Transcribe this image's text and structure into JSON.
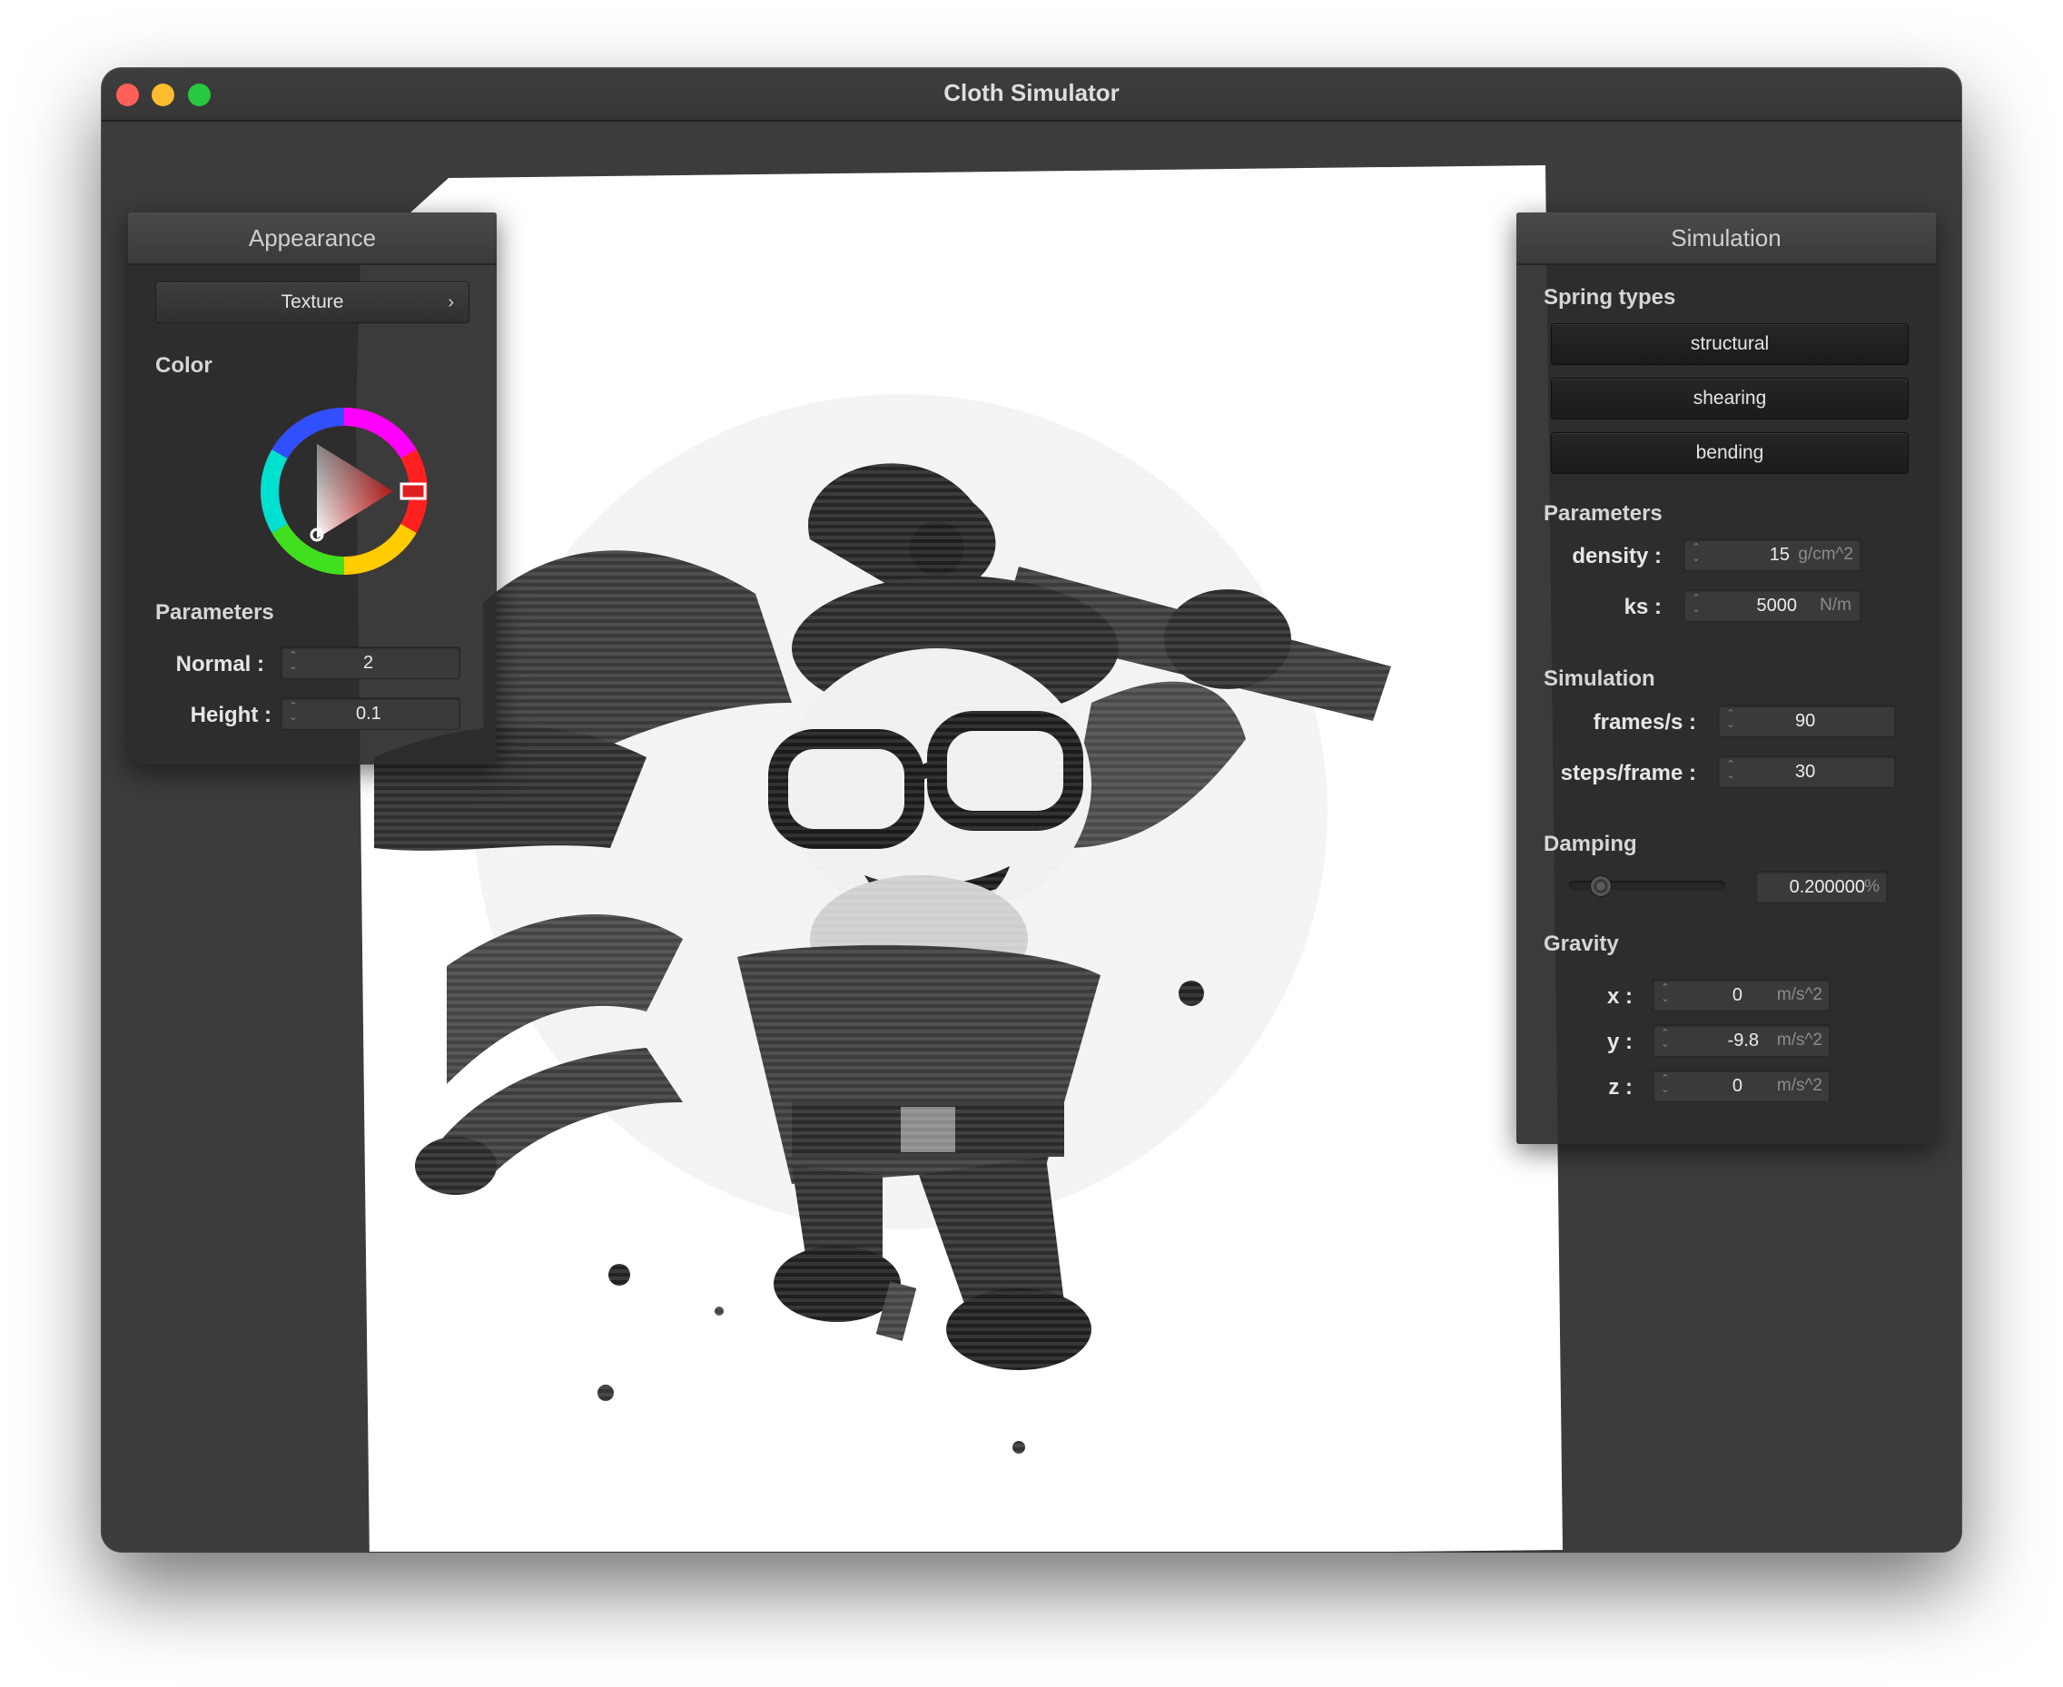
{
  "window": {
    "title": "Cloth Simulator"
  },
  "appearance": {
    "header": "Appearance",
    "texture_button": "Texture",
    "texture_chevron": "›",
    "color_label": "Color",
    "selected_color": "#e02020",
    "parameters_label": "Parameters",
    "normal": {
      "label": "Normal :",
      "value": "2"
    },
    "height": {
      "label": "Height :",
      "value": "0.1"
    }
  },
  "simulation": {
    "header": "Simulation",
    "spring_types_label": "Spring types",
    "spring_types": [
      "structural",
      "shearing",
      "bending"
    ],
    "parameters_label": "Parameters",
    "density": {
      "label": "density :",
      "value": "15",
      "unit": "g/cm^2"
    },
    "ks": {
      "label": "ks :",
      "value": "5000",
      "unit": "N/m"
    },
    "simulation_label": "Simulation",
    "frames_per_s": {
      "label": "frames/s :",
      "value": "90"
    },
    "steps_per_frame": {
      "label": "steps/frame :",
      "value": "30"
    },
    "damping_label": "Damping",
    "damping": {
      "value": "0.200000",
      "unit": "%",
      "slider_fraction": 0.2
    },
    "gravity_label": "Gravity",
    "gravity": [
      {
        "label": "x :",
        "value": "0",
        "unit": "m/s^2"
      },
      {
        "label": "y :",
        "value": "-9.8",
        "unit": "m/s^2"
      },
      {
        "label": "z :",
        "value": "0",
        "unit": "m/s^2"
      }
    ]
  },
  "icons": {
    "close": "traffic-close-icon",
    "minimize": "traffic-minimize-icon",
    "maximize": "traffic-maximize-icon",
    "spin": "stepper-icon"
  }
}
